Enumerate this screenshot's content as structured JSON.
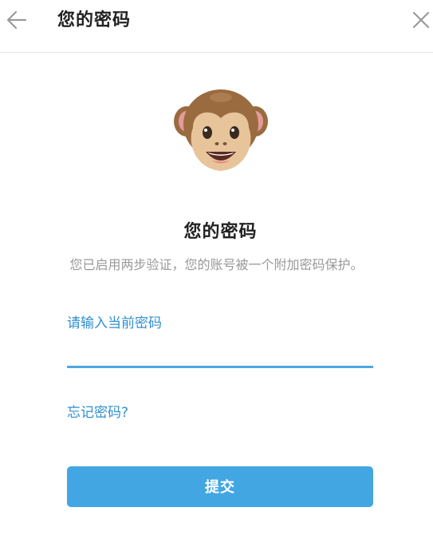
{
  "header": {
    "title": "您的密码",
    "back_icon": "arrow-left-icon",
    "close_icon": "close-icon"
  },
  "main": {
    "illustration": "monkey-face-icon",
    "title": "您的密码",
    "description": "您已启用两步验证，您的账号被一个附加密码保护。",
    "input_label": "请输入当前密码",
    "input_value": "",
    "forgot_link": "忘记密码?",
    "submit_label": "提交"
  },
  "colors": {
    "accent": "#2f8fd0",
    "button": "#42a6e3",
    "input_underline": "#4da7e2",
    "muted_text": "#999999"
  }
}
